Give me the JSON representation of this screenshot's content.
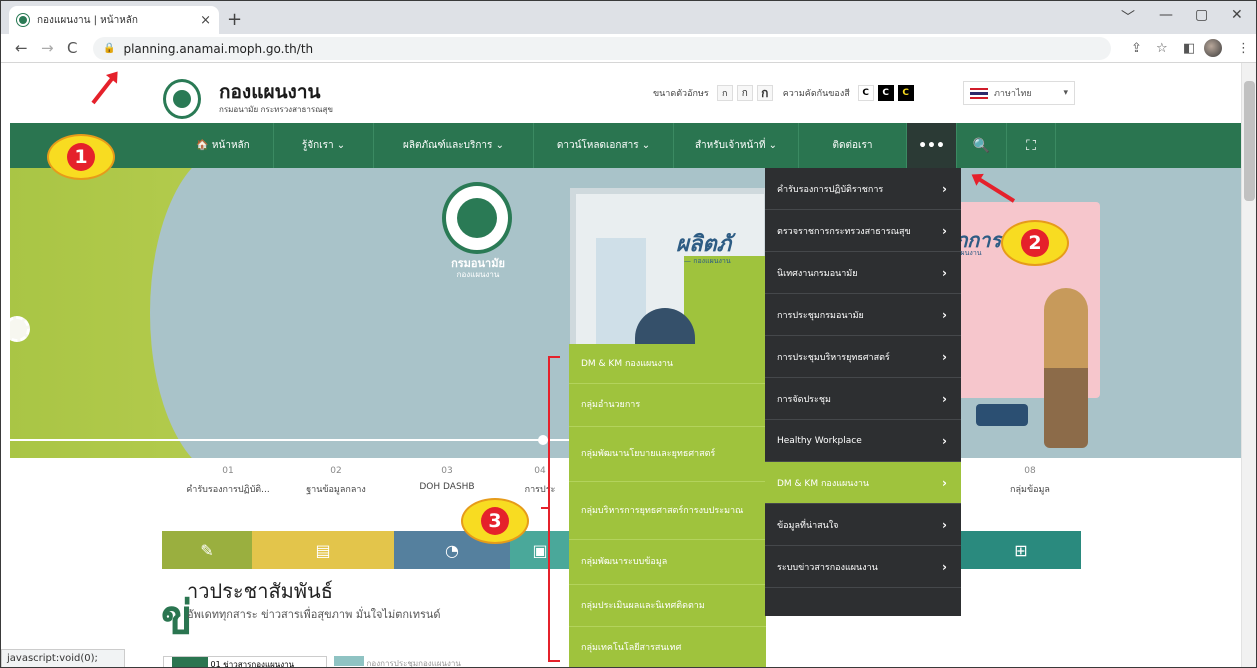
{
  "browser": {
    "tab_title": "กองแผนงาน | หน้าหลัก",
    "tab_close": "×",
    "new_tab": "+",
    "url": "planning.anamai.moph.go.th/th",
    "window_controls": [
      "﹀",
      "—",
      "▢",
      "✕"
    ],
    "nav": {
      "back": "←",
      "forward": "→",
      "reload": "C"
    }
  },
  "header": {
    "title": "กองแผนงาน",
    "subtitle": "กรมอนามัย กระทรวงสาธารณสุข",
    "font_size_label": "ขนาดตัวอักษร",
    "font_sizes": [
      "ก",
      "ก",
      "ก"
    ],
    "contrast_label": "ความคัดกันของสี",
    "contrast_options": [
      "C",
      "C",
      "C"
    ],
    "language": "ภาษาไทย",
    "language_caret": "▾"
  },
  "nav": {
    "items": [
      {
        "label": "🏠 หน้าหลัก"
      },
      {
        "label": "รู้จักเรา ⌄"
      },
      {
        "label": "ผลิตภัณฑ์และบริการ ⌄"
      },
      {
        "label": "ดาวน์โหลดเอกสาร ⌄"
      },
      {
        "label": "สำหรับเจ้าหน้าที่ ⌄"
      },
      {
        "label": "ติดต่อเรา"
      },
      {
        "label": "•••"
      },
      {
        "label": "🔍"
      },
      {
        "label": "⛶"
      }
    ]
  },
  "hero": {
    "emblem_line1": "กรมอนามัย",
    "emblem_line2": "กองแผนงาน",
    "board_heading": "ผลิตภั",
    "board_sub": "— กองแผนงาน",
    "poster_heading": "ภการ",
    "poster_sub": "แผนงาน"
  },
  "quick_links": [
    {
      "num": "01",
      "label": "คำรับรองการปฏิบัติ..."
    },
    {
      "num": "02",
      "label": "ฐานข้อมูลกลาง"
    },
    {
      "num": "03",
      "label": "DOH DASHB"
    },
    {
      "num": "04",
      "label": "การประ"
    },
    {
      "num": "08",
      "label": "กลุ่มข้อมูล"
    }
  ],
  "icon_bar": [
    {
      "icon": "✎",
      "color": "#9aaf3f"
    },
    {
      "icon": "▤",
      "color": "#e3c54b"
    },
    {
      "icon": "◔",
      "color": "#55809e"
    },
    {
      "icon": "▣",
      "color": "#4aa89a"
    },
    {
      "icon": "⊞",
      "color": "#2a8a7e"
    }
  ],
  "news": {
    "big_letter": "ข่",
    "title": "าวประชาสัมพันธ์",
    "subtitle": "อัพเดททุกสาระ ข่าวสารเพื่อสุขภาพ มั่นใจไม่ตกเทรนด์",
    "tab1": "01 ข่าวสารกองแผนงาน",
    "tab2": "กองการประชุมกองแผนงาน"
  },
  "dropdown": {
    "items": [
      {
        "label": "คำรับรองการปฏิบัติราชการ"
      },
      {
        "label": "ตรวจราชการกระทรวงสาธารณสุข"
      },
      {
        "label": "นิเทศงานกรมอนามัย"
      },
      {
        "label": "การประชุมกรมอนามัย"
      },
      {
        "label": "การประชุมบริหารยุทธศาสตร์"
      },
      {
        "label": "การจัดประชุม"
      },
      {
        "label": "Healthy Workplace"
      },
      {
        "label": "DM & KM กองแผนงาน",
        "active": true
      },
      {
        "label": "ข้อมูลที่น่าสนใจ"
      },
      {
        "label": "ระบบข่าวสารกองแผนงาน"
      }
    ],
    "arrow": "›"
  },
  "submenu": {
    "items": [
      {
        "label": "DM & KM กองแผนงาน"
      },
      {
        "label": "กลุ่มอำนวยการ"
      },
      {
        "label": "กลุ่มพัฒนานโยบายและยุทธศาสตร์"
      },
      {
        "label": "กลุ่มบริหารการยุทธศาสตร์การงบประมาณ"
      },
      {
        "label": "กลุ่มพัฒนาระบบข้อมูล"
      },
      {
        "label": "กลุ่มประเมินผลและนิเทศติดตาม"
      },
      {
        "label": "กลุ่มเทคโนโลยีสารสนเทศ"
      }
    ]
  },
  "annotations": {
    "badge1": "1",
    "badge2": "2",
    "badge3": "3"
  },
  "status_bar": "javascript:void(0);",
  "colors": {
    "nav_green": "#2a7550",
    "accent_lime": "#9fc33d",
    "dropdown_dark": "#2d2f31",
    "annotation_red": "#e5212b",
    "annotation_yellow": "#f8dc21"
  }
}
